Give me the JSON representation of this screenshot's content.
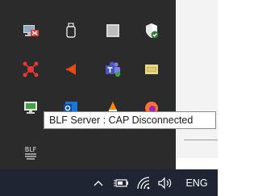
{
  "tooltip": {
    "text": "BLF Server : CAP Disconnected"
  },
  "tray_icons": [
    {
      "name": "remote-desktop-icon"
    },
    {
      "name": "usb-drive-icon"
    },
    {
      "name": "gray-square-app-icon"
    },
    {
      "name": "security-shield-icon"
    },
    {
      "name": "red-network-icon"
    },
    {
      "name": "speaker-app-icon"
    },
    {
      "name": "teams-icon"
    },
    {
      "name": "keyboard-app-icon"
    },
    {
      "name": "network-monitor-icon"
    },
    {
      "name": "outlook-icon"
    },
    {
      "name": "vlc-icon"
    },
    {
      "name": "firefox-icon"
    },
    {
      "name": "blf-server-icon",
      "label": "BLF"
    }
  ],
  "taskbar": {
    "language": "ENG",
    "icons": [
      "show-hidden-icons-chevron-icon",
      "battery-power-icon",
      "wifi-icon",
      "volume-icon"
    ]
  },
  "colors": {
    "panel": "#2b2b2b",
    "taskbar": "#1f2532",
    "tooltip_bg": "#ffffff"
  }
}
